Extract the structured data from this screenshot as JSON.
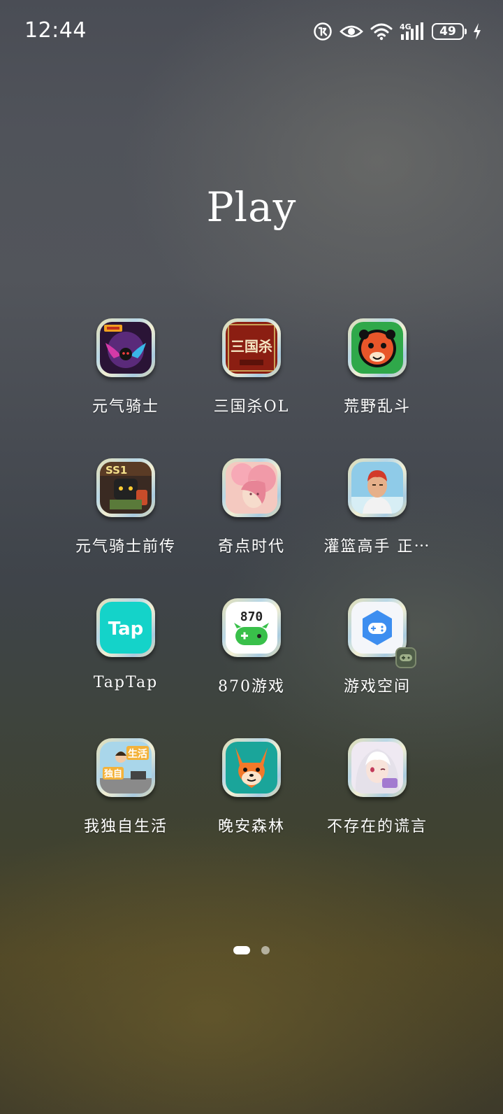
{
  "status_bar": {
    "time": "12:44",
    "battery_level": "49",
    "network_label": "4G",
    "icons": [
      "app-notification-icon",
      "eye-comfort-icon",
      "wifi-icon",
      "cellular-4g-icon",
      "battery-icon",
      "charging-icon"
    ]
  },
  "folder": {
    "title": "Play"
  },
  "apps": [
    {
      "label": "元气骑士",
      "icon": "soul-knight-icon"
    },
    {
      "label": "三国杀OL",
      "icon": "sanguosha-icon"
    },
    {
      "label": "荒野乱斗",
      "icon": "brawl-stars-icon"
    },
    {
      "label": "元气骑士前传",
      "icon": "soul-knight-prequel-icon"
    },
    {
      "label": "奇点时代",
      "icon": "singularity-era-icon"
    },
    {
      "label": "灌篮高手 正⋯",
      "icon": "slam-dunk-icon"
    },
    {
      "label": "TapTap",
      "icon": "taptap-icon"
    },
    {
      "label": "870游戏",
      "icon": "870-games-icon"
    },
    {
      "label": "游戏空间",
      "icon": "game-space-icon"
    },
    {
      "label": "我独自生活",
      "icon": "living-alone-icon"
    },
    {
      "label": "晚安森林",
      "icon": "goodnight-forest-icon"
    },
    {
      "label": "不存在的谎言",
      "icon": "nonexistent-lie-icon"
    }
  ],
  "app_icon_texts": {
    "sanguosha": "三国杀",
    "soul_knight_prequel": "SS1",
    "taptap": "Tap",
    "g870": "870",
    "living_alone_top": "生活",
    "living_alone_bottom": "独自"
  },
  "pagination": {
    "pages": 2,
    "current": 1
  },
  "colors": {
    "taptap": "#14d3c9",
    "game_space": "#3d8ef0",
    "sanguosha": "#8b1e12",
    "brawl_stars": "#2fa84a",
    "goodnight_forest": "#1aa59a"
  }
}
